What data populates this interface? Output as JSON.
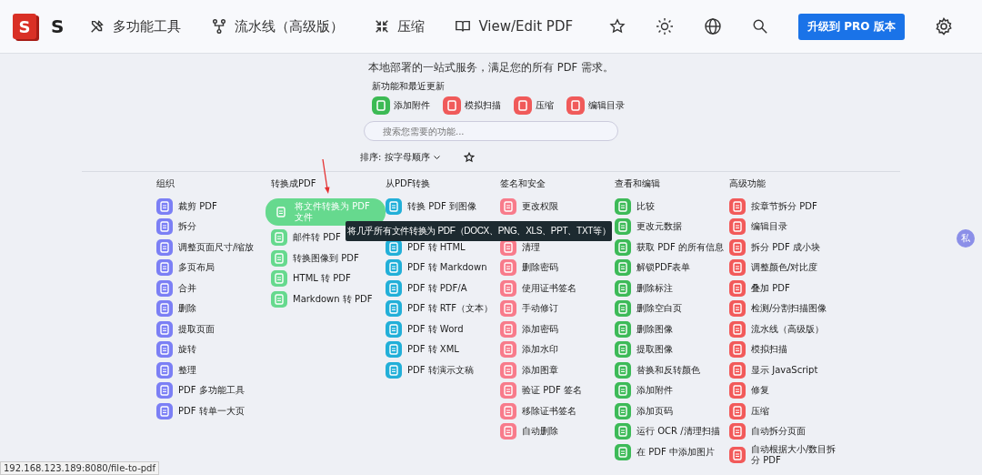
{
  "header": {
    "logo_letter": "S",
    "brand_text": "S",
    "nav": [
      {
        "kind": "tools",
        "label": "多功能工具"
      },
      {
        "kind": "pipeline",
        "label": "流水线（高级版）"
      },
      {
        "kind": "compress",
        "label": "压缩"
      },
      {
        "kind": "book",
        "label": "View/Edit PDF"
      }
    ],
    "upgrade_button": "升级到 PRO 版本"
  },
  "tagline": "本地部署的一站式服务，满足您的所有 PDF 需求。",
  "recent": {
    "title": "新功能和最近更新",
    "items": [
      {
        "label": "添加附件",
        "color": "#3cba54"
      },
      {
        "label": "模拟扫描",
        "color": "#f05a5a"
      },
      {
        "label": "压缩",
        "color": "#f05a5a"
      },
      {
        "label": "编辑目录",
        "color": "#f05a5a"
      }
    ]
  },
  "search": {
    "placeholder": "搜索您需要的功能..."
  },
  "sort": {
    "label": "排序: 按字母顺序"
  },
  "sections": [
    {
      "title": "组织",
      "color": "#7b7ff5",
      "items": [
        {
          "label": "裁剪 PDF",
          "selected": false
        },
        {
          "label": "拆分",
          "selected": false
        },
        {
          "label": "调整页面尺寸/缩放",
          "selected": false
        },
        {
          "label": "多页布局",
          "selected": false
        },
        {
          "label": "合并",
          "selected": false
        },
        {
          "label": "删除",
          "selected": false
        },
        {
          "label": "提取页面",
          "selected": false
        },
        {
          "label": "旋转",
          "selected": false
        },
        {
          "label": "整理",
          "selected": false
        },
        {
          "label": "PDF 多功能工具",
          "selected": false
        },
        {
          "label": "PDF 转单一大页",
          "selected": false
        }
      ]
    },
    {
      "title": "转换成PDF",
      "color": "#66d98e",
      "items": [
        {
          "label": "将文件转换为 PDF 文件",
          "selected": true
        },
        {
          "label": "邮件转 PDF",
          "selected": false
        },
        {
          "label": "转换图像到 PDF",
          "selected": false
        },
        {
          "label": "HTML 转 PDF",
          "selected": false
        },
        {
          "label": "Markdown 转 PDF",
          "selected": false
        }
      ]
    },
    {
      "title": "从PDF转换",
      "color": "#22afd8",
      "items": [
        {
          "label": "转换 PDF 到图像",
          "selected": false
        },
        {
          "kind": "covered"
        },
        {
          "label": "PDF 转 HTML",
          "selected": false
        },
        {
          "label": "PDF 转 Markdown",
          "selected": false
        },
        {
          "label": "PDF 转 PDF/A",
          "selected": false
        },
        {
          "label": "PDF 转 RTF（文本）",
          "selected": false
        },
        {
          "label": "PDF 转 Word",
          "selected": false
        },
        {
          "label": "PDF 转 XML",
          "selected": false
        },
        {
          "label": "PDF 转演示文稿",
          "selected": false
        }
      ]
    },
    {
      "title": "签名和安全",
      "color": "#f87b8b",
      "items": [
        {
          "label": "更改权限",
          "selected": false
        },
        {
          "kind": "covered"
        },
        {
          "label": "清理",
          "selected": false
        },
        {
          "label": "删除密码",
          "selected": false
        },
        {
          "label": "使用证书签名",
          "selected": false
        },
        {
          "label": "手动修订",
          "selected": false
        },
        {
          "label": "添加密码",
          "selected": false
        },
        {
          "label": "添加水印",
          "selected": false
        },
        {
          "label": "添加图章",
          "selected": false
        },
        {
          "label": "验证 PDF 签名",
          "selected": false
        },
        {
          "label": "移除证书签名",
          "selected": false
        },
        {
          "label": "自动删除",
          "selected": false
        }
      ]
    },
    {
      "title": "查看和编辑",
      "color": "#3dba58",
      "items": [
        {
          "label": "比较",
          "selected": false
        },
        {
          "label": "更改元数据",
          "selected": false
        },
        {
          "label": "获取 PDF 的所有信息",
          "selected": false
        },
        {
          "label": "解锁PDF表单",
          "selected": false
        },
        {
          "label": "删除标注",
          "selected": false
        },
        {
          "label": "删除空白页",
          "selected": false
        },
        {
          "label": "删除图像",
          "selected": false
        },
        {
          "label": "提取图像",
          "selected": false
        },
        {
          "label": "替换和反转颜色",
          "selected": false
        },
        {
          "label": "添加附件",
          "selected": false
        },
        {
          "label": "添加页码",
          "selected": false
        },
        {
          "label": "运行 OCR /清理扫描",
          "selected": false
        },
        {
          "label": "在 PDF 中添加图片",
          "selected": false
        }
      ]
    },
    {
      "title": "高级功能",
      "color": "#f25a5a",
      "items": [
        {
          "label": "按章节拆分 PDF",
          "selected": false
        },
        {
          "label": "编辑目录",
          "selected": false
        },
        {
          "label": "拆分 PDF 成小块",
          "selected": false
        },
        {
          "label": "调整颜色/对比度",
          "selected": false
        },
        {
          "label": "叠加 PDF",
          "selected": false
        },
        {
          "label": "检测/分割扫描图像",
          "selected": false
        },
        {
          "label": "流水线（高级版）",
          "selected": false
        },
        {
          "label": "模拟扫描",
          "selected": false
        },
        {
          "label": "显示 JavaScript",
          "selected": false
        },
        {
          "label": "修复",
          "selected": false
        },
        {
          "label": "压缩",
          "selected": false
        },
        {
          "label": "自动拆分页面",
          "selected": false
        },
        {
          "label": "自动根据大小/数目拆分 PDF",
          "selected": false
        }
      ]
    }
  ],
  "tooltip": {
    "text": "将几乎所有文件转换为 PDF（DOCX、PNG、XLS、PPT、TXT等）"
  },
  "side_badge": "私",
  "status_url": "192.168.123.189:8080/file-to-pdf"
}
